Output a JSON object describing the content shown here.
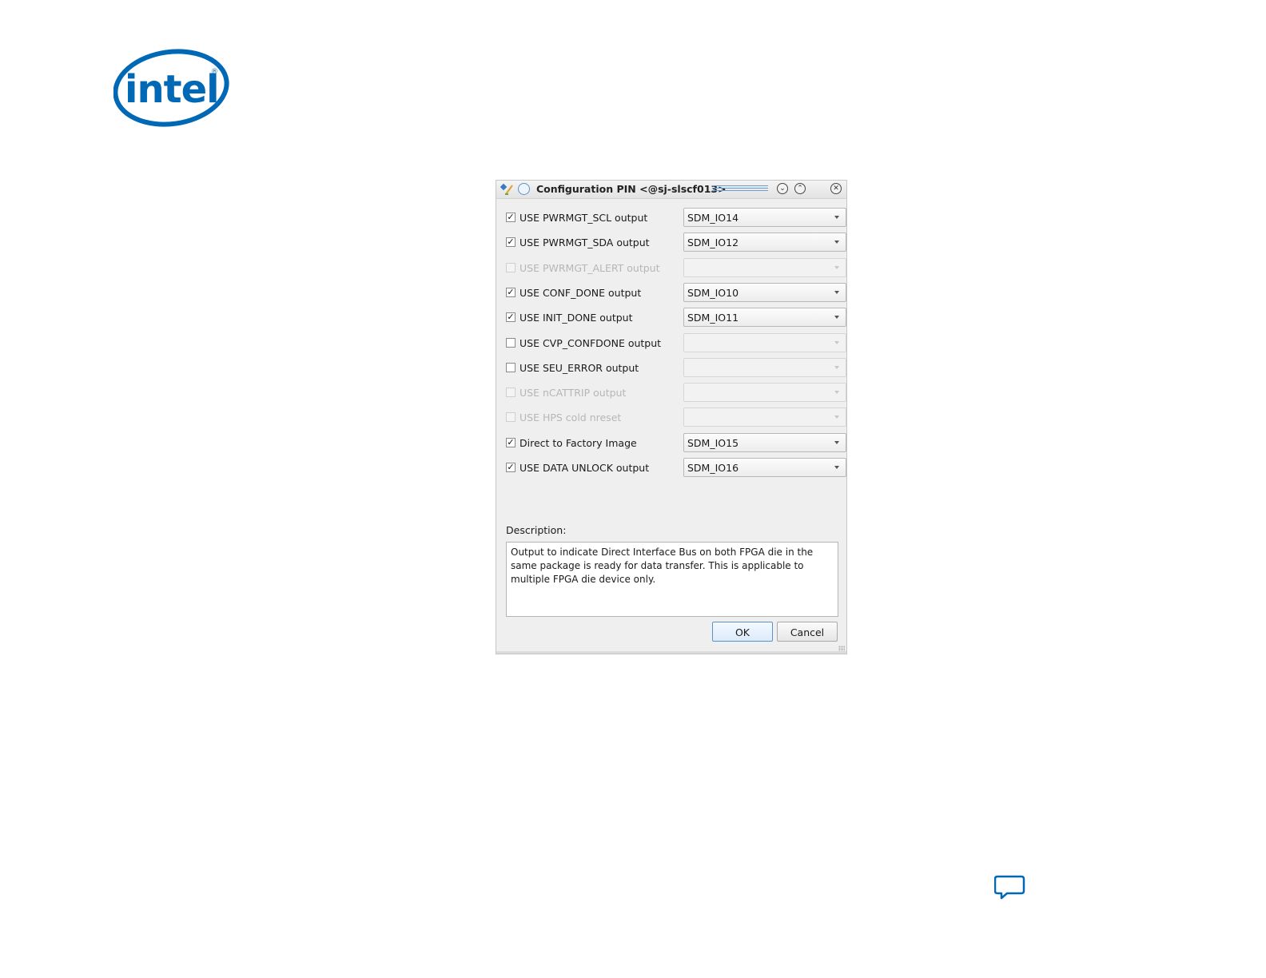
{
  "brand": {
    "logo_text": "intel",
    "logo_mark": "®",
    "brand_color": "#0068b5"
  },
  "dialog": {
    "title": "Configuration PIN <@sj-slscf013>",
    "icons": {
      "app": "app-icon",
      "status": "circle-icon",
      "minimize": "minimize-icon",
      "maximize": "maximize-icon",
      "close": "close-icon"
    },
    "titlebar_buttons": {
      "minimize": "⌄",
      "maximize": "⌃",
      "close": "✕"
    },
    "rows": [
      {
        "label": "USE PWRMGT_SCL output",
        "checked": true,
        "enabled": true,
        "value": "SDM_IO14"
      },
      {
        "label": "USE PWRMGT_SDA output",
        "checked": true,
        "enabled": true,
        "value": "SDM_IO12"
      },
      {
        "label": "USE PWRMGT_ALERT output",
        "checked": false,
        "enabled": false,
        "value": ""
      },
      {
        "label": "USE CONF_DONE output",
        "checked": true,
        "enabled": true,
        "value": "SDM_IO10"
      },
      {
        "label": "USE INIT_DONE output",
        "checked": true,
        "enabled": true,
        "value": "SDM_IO11"
      },
      {
        "label": "USE CVP_CONFDONE output",
        "checked": false,
        "enabled": true,
        "value": ""
      },
      {
        "label": "USE SEU_ERROR output",
        "checked": false,
        "enabled": true,
        "value": ""
      },
      {
        "label": "USE nCATTRIP output",
        "checked": false,
        "enabled": false,
        "value": ""
      },
      {
        "label": "USE HPS cold nreset",
        "checked": false,
        "enabled": false,
        "value": ""
      },
      {
        "label": "Direct to Factory Image",
        "checked": true,
        "enabled": true,
        "value": "SDM_IO15"
      },
      {
        "label": "USE DATA UNLOCK output",
        "checked": true,
        "enabled": true,
        "value": "SDM_IO16"
      }
    ],
    "checkmark": "✓",
    "description_label": "Description:",
    "description_text": "Output to indicate Direct Interface Bus on both FPGA die in the same package is ready for data transfer. This is applicable to multiple FPGA die device only.",
    "ok_label": "OK",
    "cancel_label": "Cancel"
  },
  "feedback": {
    "icon": "feedback-icon",
    "color": "#0068b5"
  }
}
